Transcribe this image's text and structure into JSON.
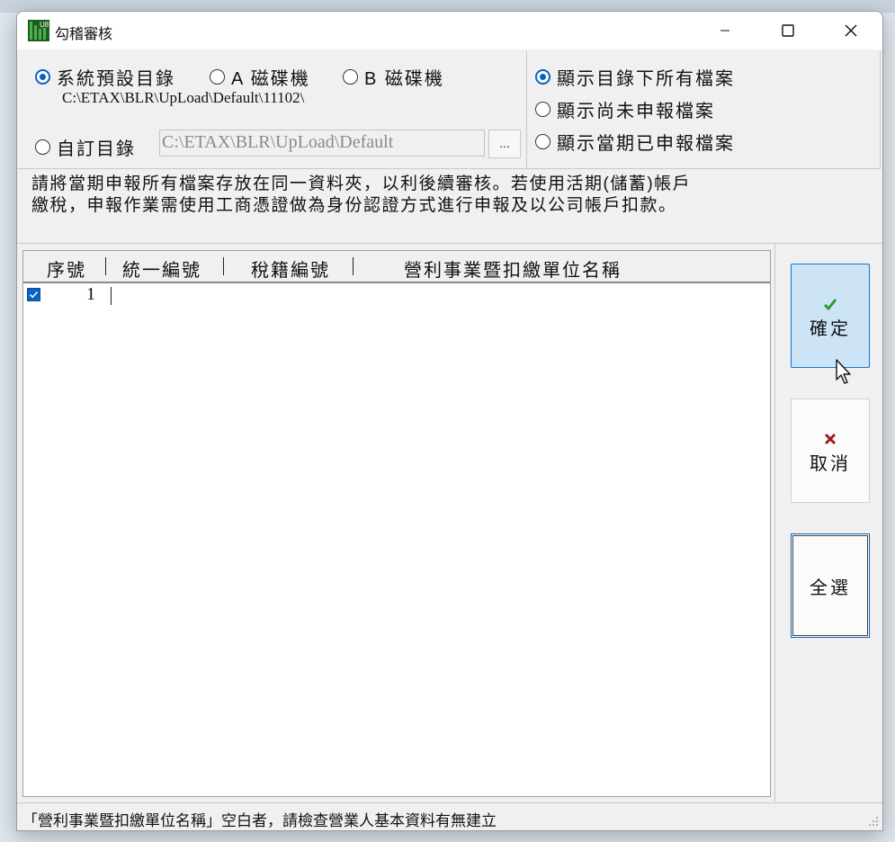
{
  "window": {
    "title": "勾稽審核",
    "icon_label": "U8"
  },
  "directory": {
    "options": [
      {
        "label": "系統預設目錄",
        "selected": true
      },
      {
        "label": "A 磁碟機",
        "selected": false
      },
      {
        "label": "B 磁碟機",
        "selected": false
      }
    ],
    "default_path": "C:\\ETAX\\BLR\\UpLoad\\Default\\11102\\",
    "custom_label": "自訂目錄",
    "custom_selected": false,
    "custom_path_value": "C:\\ETAX\\BLR\\UpLoad\\Default",
    "browse_label": "..."
  },
  "filter": {
    "options": [
      {
        "label": "顯示目錄下所有檔案",
        "selected": true
      },
      {
        "label": "顯示尚未申報檔案",
        "selected": false
      },
      {
        "label": "顯示當期已申報檔案",
        "selected": false
      }
    ]
  },
  "info": {
    "line1": "請將當期申報所有檔案存放在同一資料夾，以利後續審核。若使用活期(儲蓄)帳戶",
    "line2": "繳稅，申報作業需使用工商憑證做為身份認證方式進行申報及以公司帳戶扣款。"
  },
  "grid": {
    "columns": [
      "序號",
      "統一編號",
      "稅籍編號",
      "營利事業暨扣繳單位名稱"
    ],
    "rows": [
      {
        "checked": true,
        "seq": "1"
      }
    ]
  },
  "buttons": {
    "confirm": "確定",
    "cancel": "取消",
    "select_all": "全選"
  },
  "status": {
    "text": "「營利事業暨扣繳單位名稱」空白者，請檢查營業人基本資料有無建立"
  },
  "colors": {
    "accent": "#0a62c2",
    "confirm_bg": "#cde4f7",
    "ok_check": "#2a9d2a",
    "cancel_x": "#9b1c1c"
  }
}
